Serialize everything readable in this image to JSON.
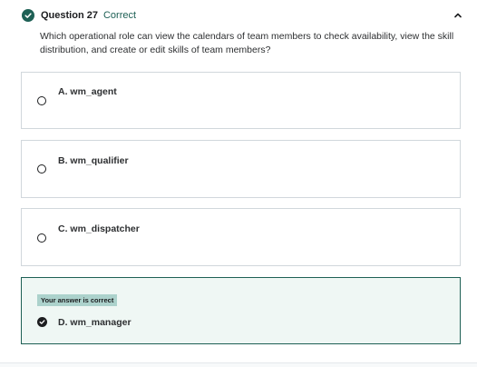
{
  "question": {
    "number": "Question 27",
    "status": "Correct",
    "text": "Which operational role can view the calendars of team members to check availability, view the skill distribution, and create or edit skills of team members?"
  },
  "options": [
    {
      "label": "A. wm_agent",
      "selected": false,
      "correct": false
    },
    {
      "label": "B. wm_qualifier",
      "selected": false,
      "correct": false
    },
    {
      "label": "C. wm_dispatcher",
      "selected": false,
      "correct": false
    },
    {
      "label": "D. wm_manager",
      "selected": true,
      "correct": true
    }
  ],
  "feedback": {
    "correct_badge": "Your answer is correct"
  },
  "icons": {
    "status": "check-circle-icon",
    "collapse": "chevron-up-icon",
    "radio": "radio-empty-icon",
    "selected": "check-circle-filled-icon"
  },
  "colors": {
    "accent": "#1e6055",
    "correct_bg": "#eff7f4",
    "badge_bg": "#acd2cc",
    "border": "#d1d7dc"
  }
}
